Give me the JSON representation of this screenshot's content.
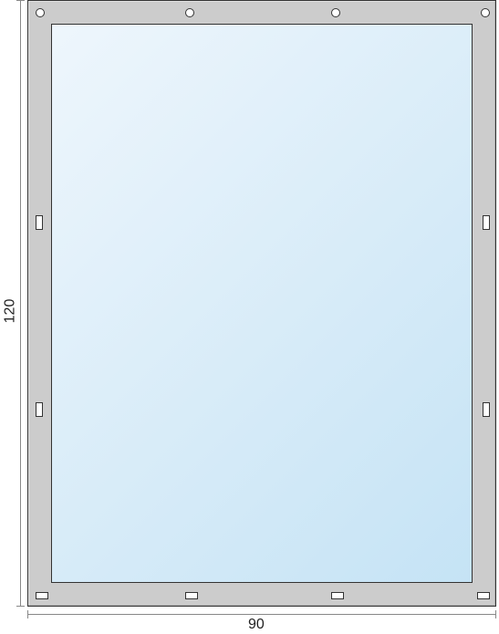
{
  "dimensions": {
    "height_label": "120",
    "width_label": "90"
  },
  "holes_top_count": 4,
  "slots_side_count_each": 2,
  "slots_bottom_count": 4
}
